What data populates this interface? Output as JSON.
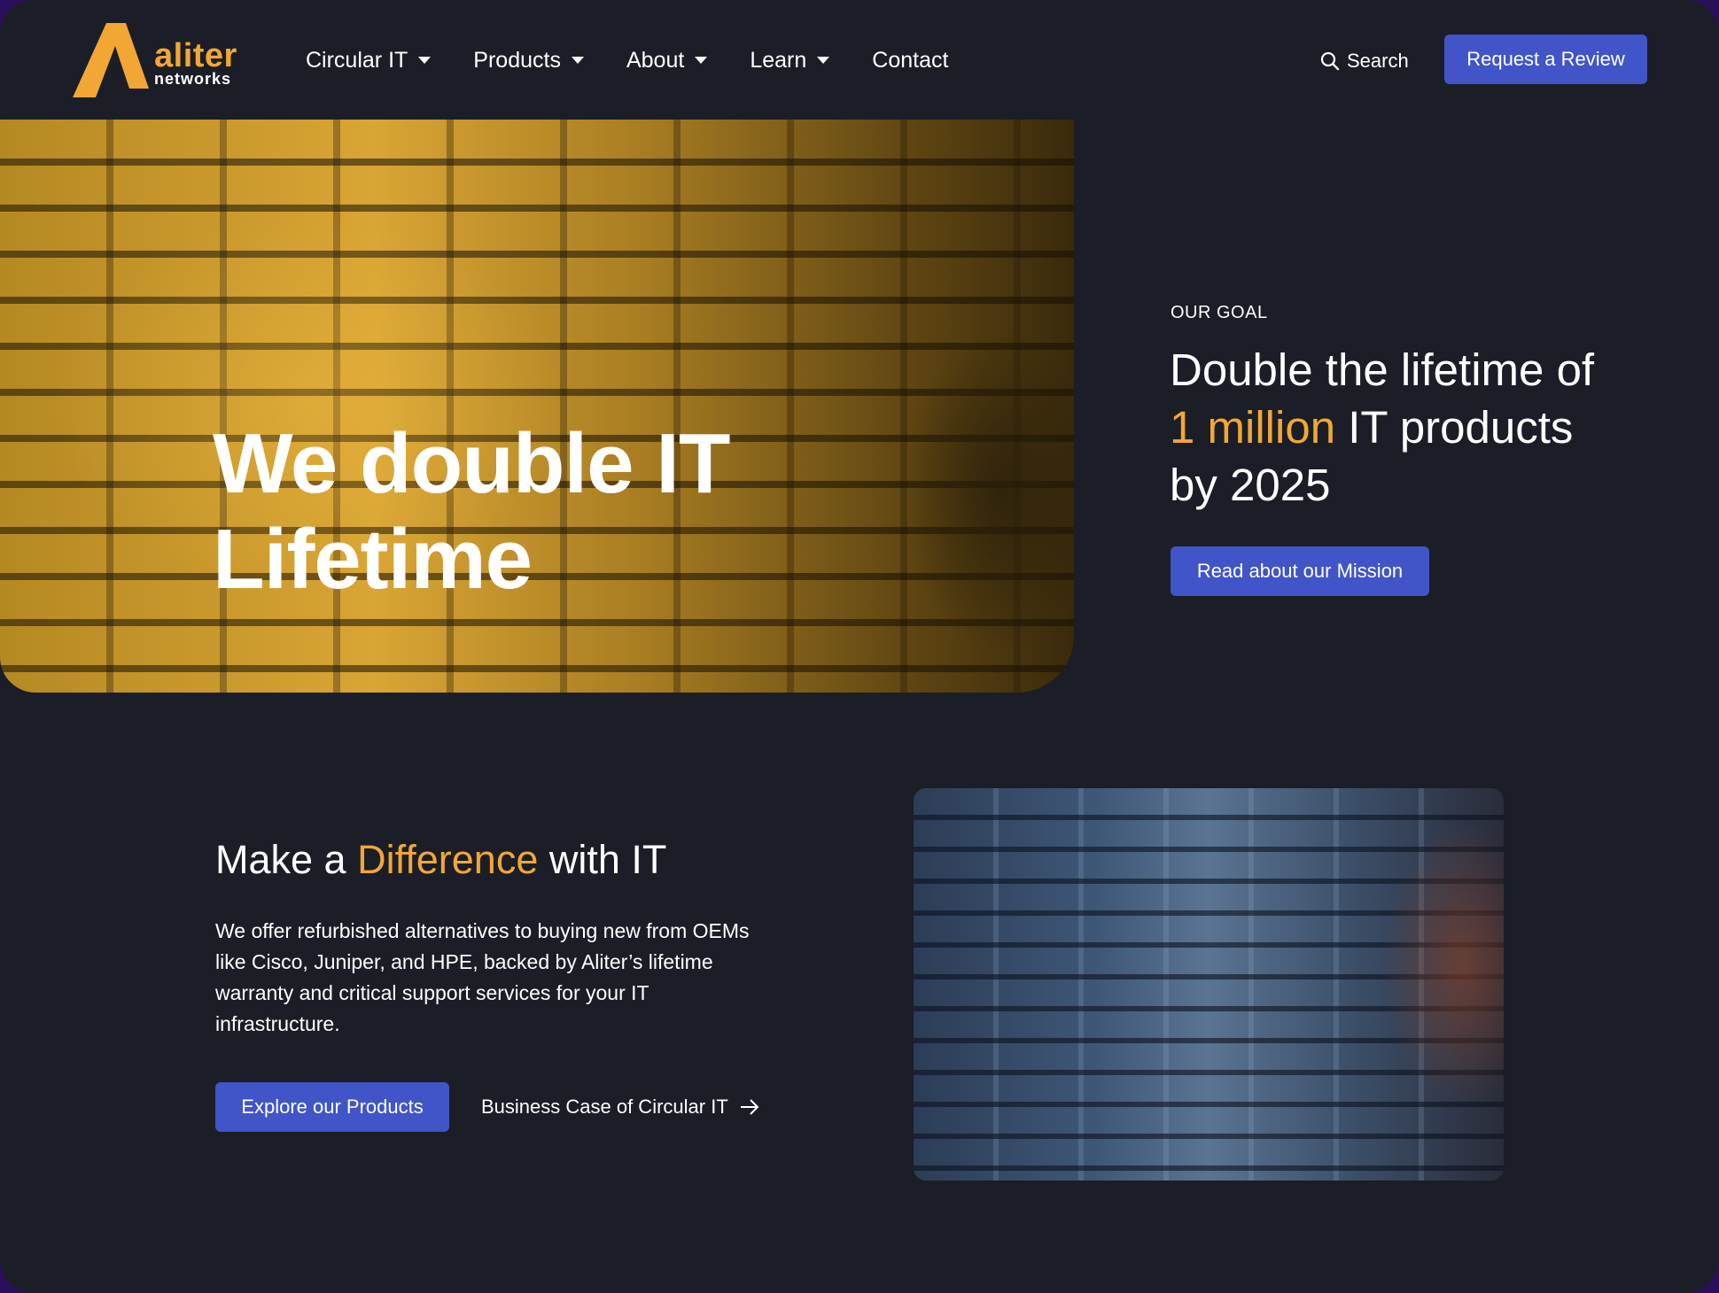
{
  "header": {
    "logo": {
      "name": "aliter",
      "sub": "networks"
    },
    "nav": [
      {
        "label": "Circular IT",
        "dropdown": true
      },
      {
        "label": "Products",
        "dropdown": true
      },
      {
        "label": "About",
        "dropdown": true
      },
      {
        "label": "Learn",
        "dropdown": true
      },
      {
        "label": "Contact",
        "dropdown": false
      }
    ],
    "search_label": "Search",
    "cta_label": "Request a Review"
  },
  "hero": {
    "title_line1": "We double IT",
    "title_line2": "Lifetime",
    "image": "server-rack-photo-gold-tint"
  },
  "goal": {
    "eyebrow": "OUR GOAL",
    "title_part1": "Double the lifetime of ",
    "title_accent": "1 million",
    "title_part2": " IT products by 2025",
    "button_label": "Read about our Mission"
  },
  "difference": {
    "title_part1": "Make a ",
    "title_accent": "Difference",
    "title_part2": " with IT",
    "body": "We offer refurbished alternatives to buying new from OEMs like Cisco, Juniper, and HPE, backed by Aliter’s lifetime warranty and critical support services for your IT infrastructure.",
    "primary_label": "Explore our Products",
    "secondary_label": "Business Case of Circular IT",
    "image": "server-rack-photo-blue-tint"
  },
  "colors": {
    "background": "#1b1e27",
    "accent": "#f2a734",
    "button": "#4155c9",
    "outer": "#2a0f5c"
  },
  "icons": [
    "logo-a-icon",
    "chevron-down-icon",
    "search-icon",
    "arrow-right-icon"
  ]
}
